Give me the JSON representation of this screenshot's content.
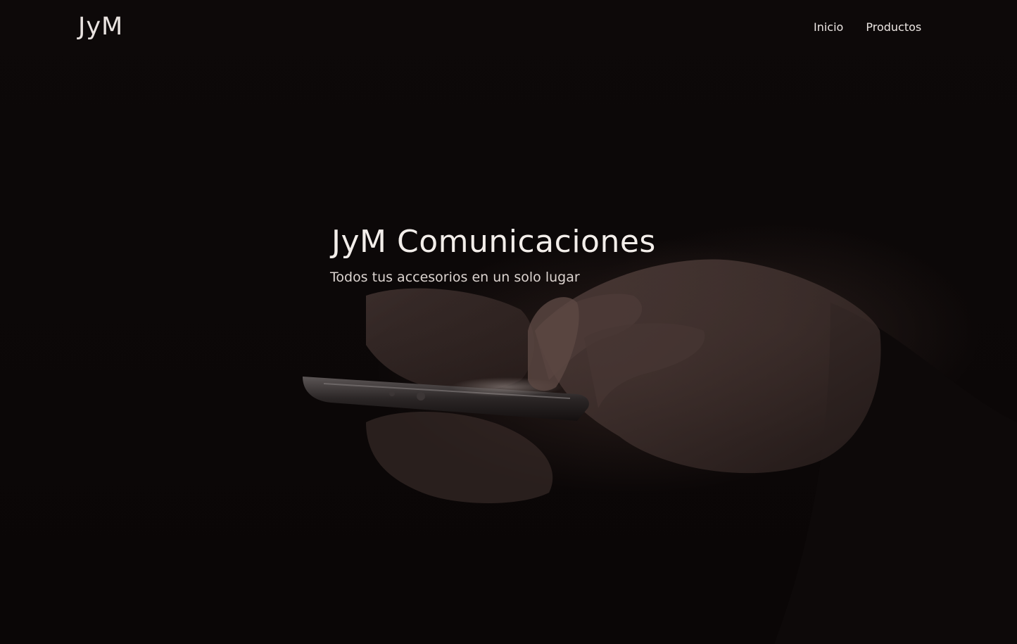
{
  "navbar": {
    "brand": "JyM",
    "links": [
      {
        "label": "Inicio"
      },
      {
        "label": "Productos"
      }
    ]
  },
  "hero": {
    "title": "JyM Comunicaciones",
    "subtitle": "Todos tus accesorios en un solo lugar",
    "background_image": "hands-holding-smartphone-photo",
    "overlay_color": "#0a0606",
    "text_color": "#f3eeea"
  }
}
